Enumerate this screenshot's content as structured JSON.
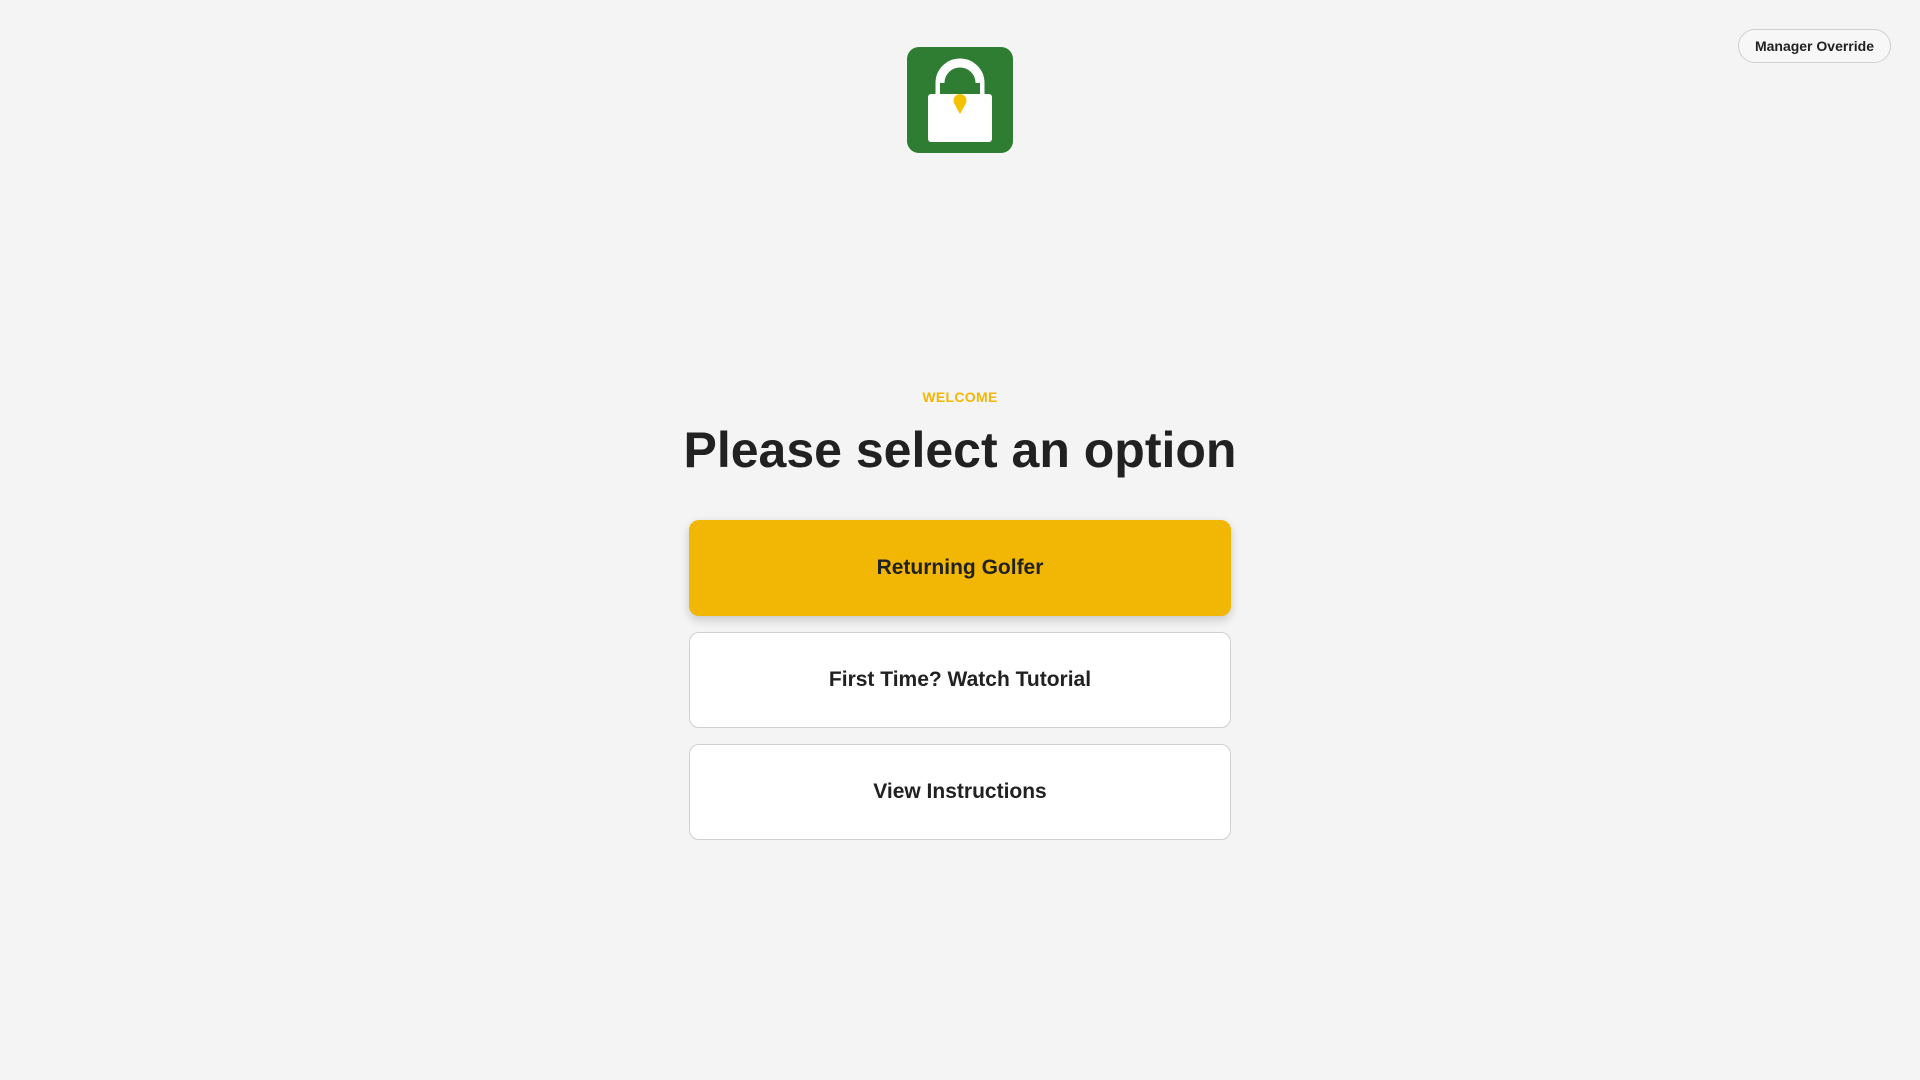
{
  "header": {
    "override_label": "Manager Override",
    "logo_icon": "lock-bag-icon"
  },
  "main": {
    "eyebrow": "WELCOME",
    "title": "Please select an option",
    "options": [
      {
        "label": "Returning Golfer",
        "style": "primary"
      },
      {
        "label": "First Time? Watch Tutorial",
        "style": "secondary"
      },
      {
        "label": "View Instructions",
        "style": "secondary"
      }
    ]
  },
  "colors": {
    "background": "#f4f4f4",
    "brand_green": "#2e7d32",
    "accent_yellow": "#f2b705",
    "text": "#212121"
  }
}
